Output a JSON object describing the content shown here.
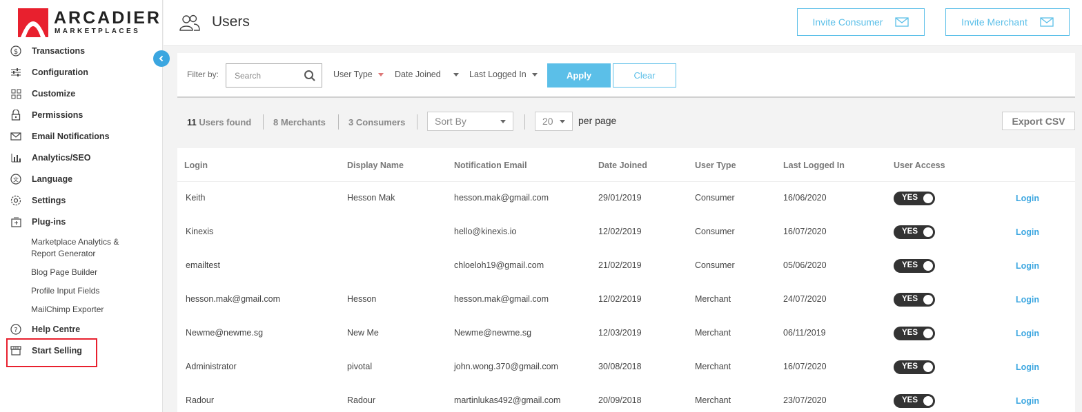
{
  "brand": {
    "name": "ARCADIER",
    "tagline": "MARKETPLACES"
  },
  "sidebar": {
    "items": [
      {
        "label": "Transactions",
        "icon": "dollar-circle-icon"
      },
      {
        "label": "Configuration",
        "icon": "sliders-icon"
      },
      {
        "label": "Customize",
        "icon": "grid-icon"
      },
      {
        "label": "Permissions",
        "icon": "lock-icon"
      },
      {
        "label": "Email Notifications",
        "icon": "envelope-icon"
      },
      {
        "label": "Analytics/SEO",
        "icon": "bar-chart-icon"
      },
      {
        "label": "Language",
        "icon": "translate-icon"
      },
      {
        "label": "Settings",
        "icon": "gear-icon"
      },
      {
        "label": "Plug-ins",
        "icon": "plugin-icon"
      }
    ],
    "plugins": [
      "Marketplace Analytics & Report Generator",
      "Blog Page Builder",
      "Profile Input Fields",
      "MailChimp Exporter"
    ],
    "help": "Help Centre",
    "start_selling": "Start Selling"
  },
  "header": {
    "title": "Users",
    "invite_consumer": "Invite Consumer",
    "invite_merchant": "Invite Merchant"
  },
  "filter": {
    "label": "Filter by:",
    "search_placeholder": "Search",
    "user_type": "User Type",
    "date_joined": "Date Joined",
    "last_logged_in": "Last Logged In",
    "apply": "Apply",
    "clear": "Clear"
  },
  "summary": {
    "users_count": "11",
    "users_label": "Users found",
    "merchants_count": "8",
    "merchants_label": "Merchants",
    "consumers_count": "3",
    "consumers_label": "Consumers",
    "sort_by": "Sort By",
    "page_size": "20",
    "per_page": "per page",
    "export": "Export CSV"
  },
  "table": {
    "columns": [
      "Login",
      "Display Name",
      "Notification Email",
      "Date Joined",
      "User Type",
      "Last Logged In",
      "User Access"
    ],
    "rows": [
      {
        "login": "Keith",
        "display": "Hesson Mak",
        "email": "hesson.mak@gmail.com",
        "joined": "29/01/2019",
        "type": "Consumer",
        "last": "16/06/2020",
        "access": "YES",
        "action": "Login"
      },
      {
        "login": "Kinexis",
        "display": "",
        "email": "hello@kinexis.io",
        "joined": "12/02/2019",
        "type": "Consumer",
        "last": "16/07/2020",
        "access": "YES",
        "action": "Login"
      },
      {
        "login": "emailtest",
        "display": "",
        "email": "chloeloh19@gmail.com",
        "joined": "21/02/2019",
        "type": "Consumer",
        "last": "05/06/2020",
        "access": "YES",
        "action": "Login"
      },
      {
        "login": "hesson.mak@gmail.com",
        "display": "Hesson",
        "email": "hesson.mak@gmail.com",
        "joined": "12/02/2019",
        "type": "Merchant",
        "last": "24/07/2020",
        "access": "YES",
        "action": "Login"
      },
      {
        "login": "Newme@newme.sg",
        "display": "New Me",
        "email": "Newme@newme.sg",
        "joined": "12/03/2019",
        "type": "Merchant",
        "last": "06/11/2019",
        "access": "YES",
        "action": "Login"
      },
      {
        "login": "Administrator",
        "display": "pivotal",
        "email": "john.wong.370@gmail.com",
        "joined": "30/08/2018",
        "type": "Merchant",
        "last": "16/07/2020",
        "access": "YES",
        "action": "Login"
      },
      {
        "login": "Radour",
        "display": "Radour",
        "email": "martinlukas492@gmail.com",
        "joined": "20/09/2018",
        "type": "Merchant",
        "last": "23/07/2020",
        "access": "YES",
        "action": "Login"
      }
    ]
  },
  "colors": {
    "accent": "#5bbfe8",
    "highlight": "#e8202e",
    "logo_red": "#e8202e"
  }
}
